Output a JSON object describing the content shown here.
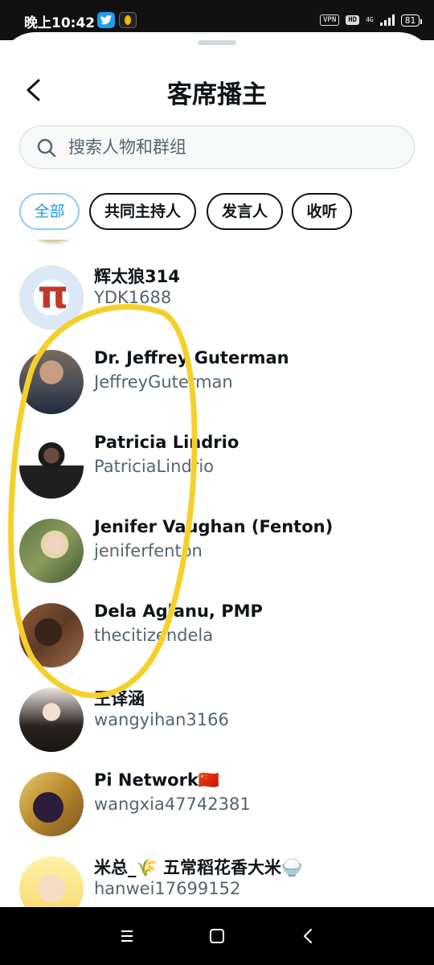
{
  "status_bar": {
    "time": "晚上10:42",
    "vpn": "VPN",
    "hd": "HD",
    "network": "4G",
    "battery": "81"
  },
  "header": {
    "title": "客席播主"
  },
  "search": {
    "placeholder": "搜索人物和群组"
  },
  "filters": [
    {
      "label": "全部",
      "active": true
    },
    {
      "label": "共同主持人",
      "active": false
    },
    {
      "label": "发言人",
      "active": false
    },
    {
      "label": "收听",
      "active": false
    }
  ],
  "users": [
    {
      "name": "辉太狼314",
      "handle": "YDK1688"
    },
    {
      "name": "Dr. Jeffrey Guterman",
      "handle": "JeffreyGuterman"
    },
    {
      "name": "Patricia Lindrio",
      "handle": "PatriciaLindrio"
    },
    {
      "name": "Jenifer Vaughan (Fenton)",
      "handle": "jeniferfenton"
    },
    {
      "name": "Dela Aglanu, PMP",
      "handle": "thecitizendela"
    },
    {
      "name": "王译涵",
      "handle": "wangyihan3166"
    },
    {
      "name": "Pi Network🇨🇳",
      "handle": "wangxia47742381"
    },
    {
      "name": "米总_🌾 五常稻花香大米🍚",
      "handle": "hanwei17699152"
    }
  ],
  "colors": {
    "accent": "#1d9bf0",
    "annotation": "#f5d02a",
    "secondary_text": "#536471"
  }
}
